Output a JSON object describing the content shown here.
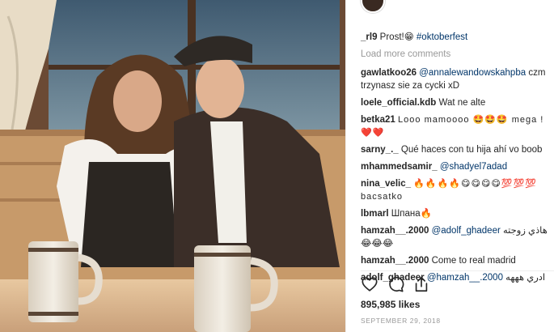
{
  "post": {
    "caption_user": "_rl9",
    "caption_text": "Prost!😁",
    "caption_tag": "#oktoberfest",
    "load_more": "Load more comments"
  },
  "comments": [
    {
      "user": "gawlatkoo26",
      "mention": "@annalewandowskahpba",
      "text": "czm trzynasz sie za cycki xD"
    },
    {
      "user": "loele_official.kdb",
      "mention": "",
      "text": "Wat ne alte"
    },
    {
      "user": "betka21",
      "mention": "",
      "text": "Looo mamoooo 🤩🤩🤩 mega ! ❤️❤️"
    },
    {
      "user": "sarny_._",
      "mention": "",
      "text": "Qué haces con tu hija ahí vo boob"
    },
    {
      "user": "mhammedsamir_",
      "mention": "@shadyel7adad",
      "text": ""
    },
    {
      "user": "nina_velic_",
      "mention": "",
      "text": "🔥🔥🔥🔥😋😋😋😋💯💯💯 bacsatko"
    },
    {
      "user": "lbmarl",
      "mention": "",
      "text": "Шпана🔥"
    },
    {
      "user": "hamzah__.2000",
      "mention": "@adolf_ghadeer",
      "text": "هاذي زوجته 😂😂😂"
    },
    {
      "user": "hamzah__.2000",
      "mention": "",
      "text": "Come to real madrid"
    },
    {
      "user": "adolf_ghadeer",
      "mention": "@hamzah__.2000",
      "text": "ادري هههه"
    }
  ],
  "actions": {
    "like_icon": "heart-icon",
    "comment_icon": "comment-icon",
    "share_icon": "share-icon"
  },
  "likes": "895,985 likes",
  "date": "SEPTEMBER 29, 2018"
}
